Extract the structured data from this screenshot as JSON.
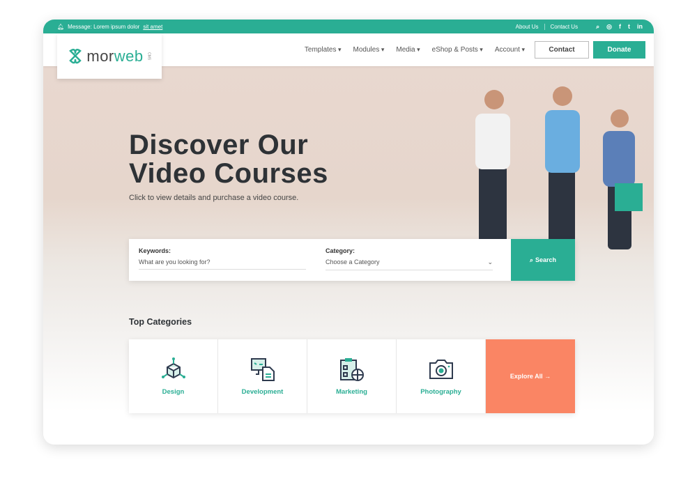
{
  "topbar": {
    "message_prefix": "Message: Lorem ipsum dolor ",
    "message_link": "sit amet",
    "links": [
      "About Us",
      "Contact Us"
    ],
    "icons": [
      "search-icon",
      "instagram-icon",
      "facebook-icon",
      "twitter-icon",
      "linkedin-icon"
    ]
  },
  "logo": {
    "text_dark": "mor",
    "text_accent": "web",
    "suffix": "CMS"
  },
  "nav": {
    "menu": [
      "Templates",
      "Modules",
      "Media",
      "eShop & Posts",
      "Account"
    ],
    "contact_label": "Contact",
    "donate_label": "Donate"
  },
  "hero": {
    "title_line1": "Discover Our",
    "title_line2": "Video Courses",
    "subtitle": "Click to view details and purchase a video course."
  },
  "search": {
    "keywords_label": "Keywords:",
    "keywords_placeholder": "What are you looking for?",
    "category_label": "Category:",
    "category_value": "Choose a Category",
    "button": "Search"
  },
  "categories": {
    "title": "Top Categories",
    "items": [
      {
        "label": "Design",
        "icon": "cube-icon"
      },
      {
        "label": "Development",
        "icon": "monitor-document-icon"
      },
      {
        "label": "Marketing",
        "icon": "clipboard-target-icon"
      },
      {
        "label": "Photography",
        "icon": "camera-icon"
      }
    ],
    "explore": "Explore All →"
  },
  "colors": {
    "accent": "#2aae94",
    "explore": "#fa8564",
    "text": "#2e3236"
  }
}
